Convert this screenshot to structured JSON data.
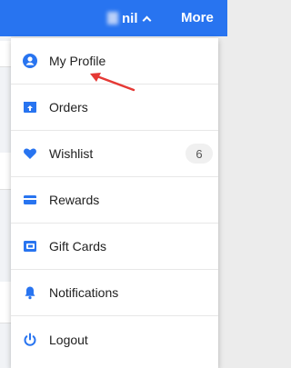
{
  "header": {
    "account_name": "nil",
    "more_label": "More"
  },
  "menu": {
    "items": [
      {
        "label": "My Profile",
        "icon": "user-circle-icon"
      },
      {
        "label": "Orders",
        "icon": "orders-box-icon"
      },
      {
        "label": "Wishlist",
        "icon": "heart-icon",
        "badge": "6"
      },
      {
        "label": "Rewards",
        "icon": "card-icon"
      },
      {
        "label": "Gift Cards",
        "icon": "gift-card-icon"
      },
      {
        "label": "Notifications",
        "icon": "bell-icon"
      },
      {
        "label": "Logout",
        "icon": "power-icon"
      }
    ]
  },
  "colors": {
    "brand": "#2874f0",
    "annotation_arrow": "#e53935"
  }
}
